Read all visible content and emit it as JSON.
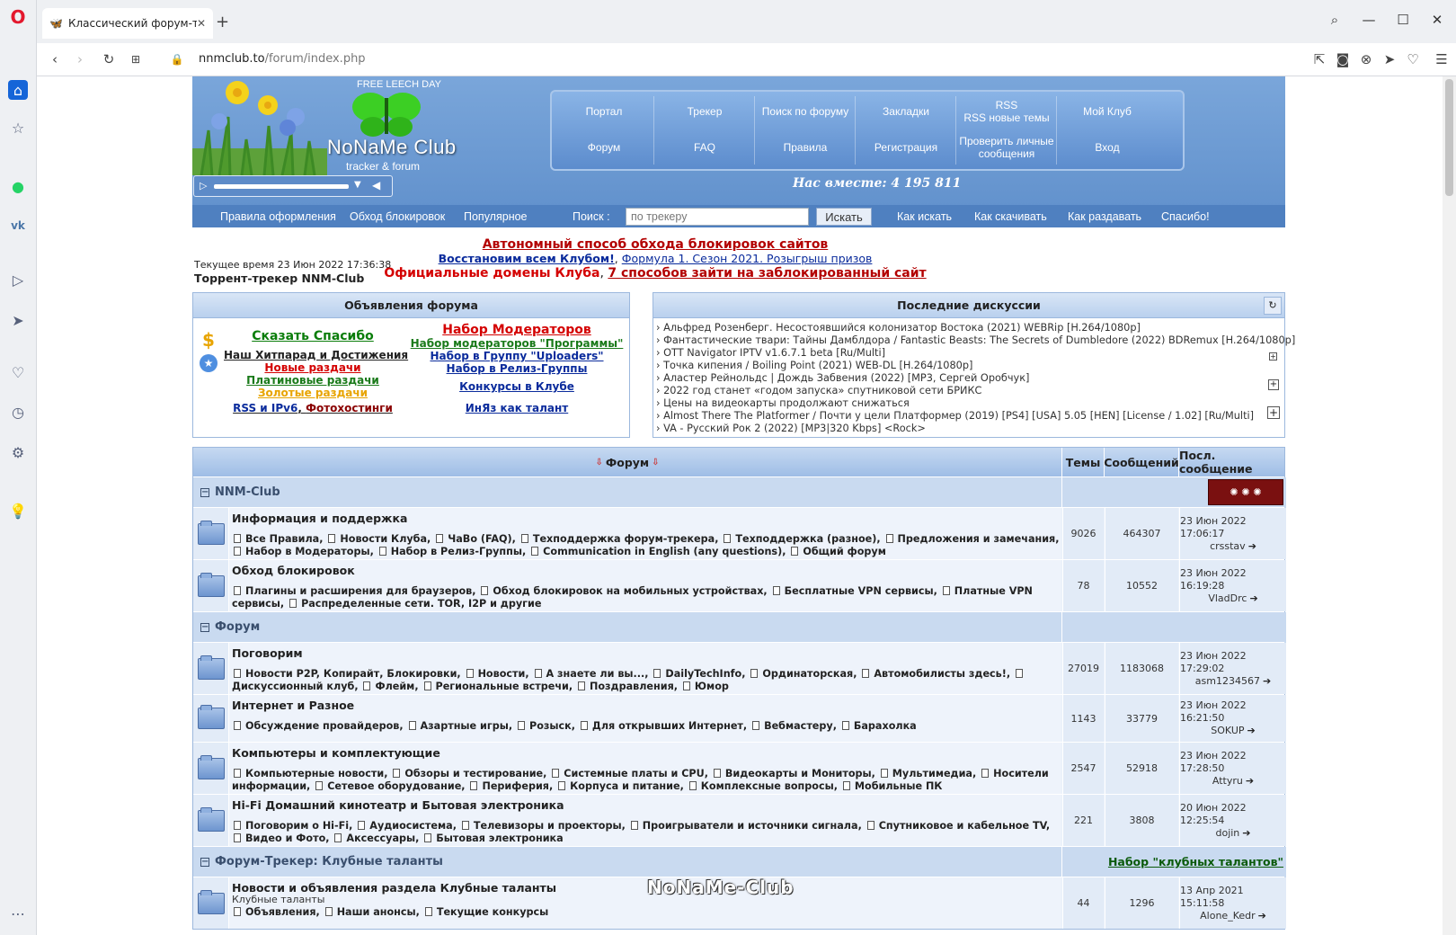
{
  "browser": {
    "tab_title": "Классический форум-тре",
    "url_host": "nnmclub.to",
    "url_path": "/forum/index.php"
  },
  "header": {
    "free_leech": "FREE LEECH DAY",
    "logo_name": "NoNaMe Club",
    "logo_sub": "tracker & forum",
    "nav_top": [
      "Портал",
      "Трекер",
      "Поиск по форуму",
      "Закладки",
      "RSS\nRSS новые темы",
      "Мой Клуб"
    ],
    "nav_bottom": [
      "Форум",
      "FAQ",
      "Правила",
      "Регистрация",
      "Проверить личные\nсообщения",
      "Вход"
    ],
    "together": "Нас вместе: 4 195 811",
    "bar_links": [
      "Правила оформления",
      "Обход блокировок",
      "Популярное"
    ],
    "search_label": "Поиск :",
    "search_placeholder": "по трекеру",
    "search_button": "Искать",
    "bar_links_right": [
      "Как искать",
      "Как скачивать",
      "Как раздавать",
      "Спасибо!"
    ]
  },
  "info": {
    "current_time": "Текущее время 23 Июн 2022 17:36:38",
    "site_title": "Торрент-трекер NNM-Club",
    "promo1": "Автономный способ обхода блокировок сайтов",
    "promo2a": "Восстановим всем Клубом!",
    "promo2b": "Формула 1. Сезон 2021. Розыгрыш призов",
    "promo3a": "Официальные домены Клуба",
    "promo3b": "7 способов зайти на заблокированный сайт"
  },
  "announcements": {
    "title": "Объявления форума",
    "say_thanks": "Сказать Спасибо",
    "hitparade": "Наш Хитпарад и Достижения",
    "new_releases": "Новые раздачи",
    "platinum": "Платиновые раздачи",
    "gold": "Золотые раздачи",
    "rss": "RSS и IPv6",
    "photohost": "Фотохостинги",
    "moderators": "Набор Модераторов",
    "mod_programs": "Набор модераторов \"Программы\"",
    "uploaders": "Набор в Группу \"Uploaders\"",
    "release_group": "Набор в Релиз-Группы",
    "contests": "Конкурсы в Клубе",
    "inyaz": "ИнЯз как талант"
  },
  "discussions": {
    "title": "Последние дискуссии",
    "items": [
      "Альфред Розенберг. Несостоявшийся колонизатор Востока (2021) WEBRip [H.264/1080p]",
      "Фантастические твари: Тайны Дамблдора / Fantastic Beasts: The Secrets of Dumbledore (2022) BDRemux [H.264/1080p]",
      "OTT Navigator IPTV v1.6.7.1 beta [Ru/Multi]",
      "Точка кипения / Boiling Point (2021) WEB-DL [H.264/1080p]",
      "Аластер Рейнольдс | Дождь Забвения (2022) [MP3, Сергей Оробчук]",
      "2022 год станет «годом запуска» спутниковой сети БРИКС",
      "Цены на видеокарты продолжают снижаться",
      "Almost There The Platformer / Почти у цели Платформер (2019) [PS4] [USA] 5.05 [HEN] [License / 1.02] [Ru/Multi]",
      "VA - Русский Рок 2 (2022) [MP3|320 Kbps] <Rock>"
    ]
  },
  "forum_table": {
    "col_forum": "Форум",
    "col_topics": "Темы",
    "col_messages": "Сообщений",
    "col_last": "Посл. сообщение",
    "categories": [
      {
        "name": "NNM-Club",
        "forums": [
          {
            "title": "Информация и поддержка",
            "subs": [
              "Все Правила",
              "Новости Клуба",
              "ЧаВо (FAQ)",
              "Техподдержка форум-трекера",
              "Техподдержка (разное)",
              "Предложения и замечания",
              "Набор в Модераторы",
              "Набор в Релиз-Группы",
              "Communication in English (any questions)",
              "Общий форум"
            ],
            "topics": "9026",
            "messages": "464307",
            "last_date": "23 Июн 2022 17:06:17",
            "last_user": "crsstav"
          },
          {
            "title": "Обход блокировок",
            "subs": [
              "Плагины и расширения для браузеров",
              "Обход блокировок на мобильных устройствах",
              "Бесплатные VPN сервисы",
              "Платные VPN сервисы",
              "Распределенные сети. TOR, I2P и другие"
            ],
            "topics": "78",
            "messages": "10552",
            "last_date": "23 Июн 2022 16:19:28",
            "last_user": "VladDrc"
          }
        ]
      },
      {
        "name": "Форум",
        "forums": [
          {
            "title": "Поговорим",
            "subs": [
              "Новости P2P, Копирайт, Блокировки",
              "Новости",
              "А знаете ли вы...",
              "DailyTechInfo",
              "Ординаторская",
              "Автомобилисты здесь!",
              "Дискуссионный клуб",
              "Флейм",
              "Региональные встречи",
              "Поздравления",
              "Юмор"
            ],
            "topics": "27019",
            "messages": "1183068",
            "last_date": "23 Июн 2022 17:29:02",
            "last_user": "asm1234567"
          },
          {
            "title": "Интернет и Разное",
            "subs": [
              "Обсуждение провайдеров",
              "Азартные игры",
              "Розыск",
              "Для открывших Интернет",
              "Вебмастеру",
              "Барахолка"
            ],
            "topics": "1143",
            "messages": "33779",
            "last_date": "23 Июн 2022 16:21:50",
            "last_user": "SOKUP"
          },
          {
            "title": "Компьютеры и комплектующие",
            "subs": [
              "Компьютерные новости",
              "Обзоры и тестирование",
              "Системные платы и CPU",
              "Видеокарты и Мониторы",
              "Мультимедиа",
              "Носители информации",
              "Сетевое оборудование",
              "Периферия",
              "Корпуса и питание",
              "Комплексные вопросы",
              "Мобильные ПК"
            ],
            "topics": "2547",
            "messages": "52918",
            "last_date": "23 Июн 2022 17:28:50",
            "last_user": "Attyru"
          },
          {
            "title": "Hi-Fi Домашний кинотеатр и Бытовая электроника",
            "subs": [
              "Поговорим о Hi-Fi",
              "Аудиосистема",
              "Телевизоры и проекторы",
              "Проигрыватели и источники сигнала",
              "Спутниковое и кабельное TV",
              "Видео и Фото",
              "Аксессуары",
              "Бытовая электроника"
            ],
            "topics": "221",
            "messages": "3808",
            "last_date": "20 Июн 2022 12:25:54",
            "last_user": "dojin"
          }
        ]
      },
      {
        "name": "Форум-Трекер: Клубные таланты",
        "link": "Набор \"клубных талантов\"",
        "forums": [
          {
            "title": "Новости и объявления раздела Клубные таланты",
            "desc": "Клубные таланты",
            "subs": [
              "Объявления",
              "Наши анонсы",
              "Текущие конкурсы"
            ],
            "topics": "44",
            "messages": "1296",
            "last_date": "13 Апр 2021 15:11:58",
            "last_user": "Alone_Kedr"
          }
        ]
      }
    ]
  },
  "watermark": "NoNaMe-Club"
}
